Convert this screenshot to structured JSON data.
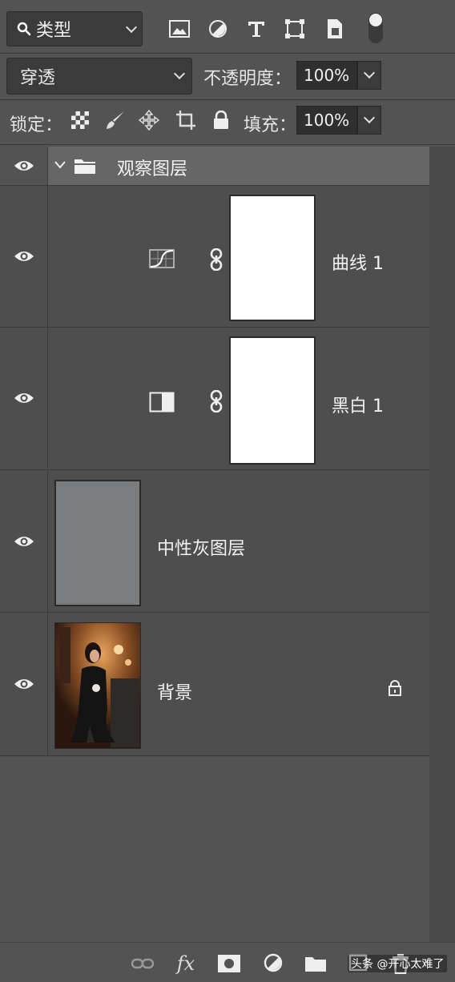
{
  "filter": {
    "label": "类型",
    "icons": [
      "image-filter-icon",
      "adjustment-filter-icon",
      "type-filter-icon",
      "shape-filter-icon",
      "smart-object-filter-icon"
    ]
  },
  "blend": {
    "mode": "穿透",
    "opacity_label": "不透明度：",
    "opacity_value": "100%"
  },
  "lock": {
    "label": "锁定：",
    "fill_label": "填充：",
    "fill_value": "100%"
  },
  "layers": [
    {
      "name": "观察图层",
      "type": "group",
      "expanded": true
    },
    {
      "name": "曲线 1",
      "type": "adjustment-curves"
    },
    {
      "name": "黑白 1",
      "type": "adjustment-black-white"
    },
    {
      "name": "中性灰图层",
      "type": "pixel",
      "fill_color": "#7b7c7e"
    },
    {
      "name": "背景",
      "type": "background",
      "locked": true
    }
  ],
  "bottom": {
    "fx_label": "fx",
    "watermark": "头条 @开心太难了"
  },
  "colors": {
    "panel": "#535353",
    "group_highlight": "#666666",
    "field_bg": "#2f2f2f"
  }
}
